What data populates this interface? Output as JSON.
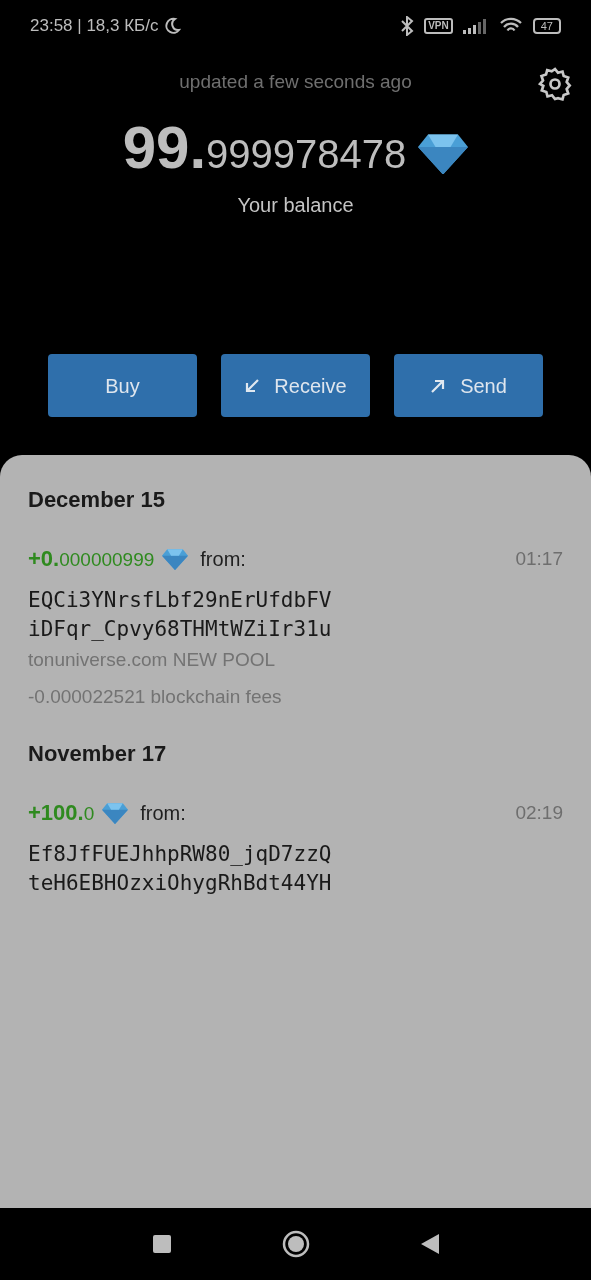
{
  "status_bar": {
    "time": "23:58 | 18,3 КБ/с",
    "vpn": "VPN",
    "battery": "47"
  },
  "header": {
    "updated": "updated a few seconds ago"
  },
  "balance": {
    "whole": "99.",
    "fraction": "999978478",
    "label": "Your balance"
  },
  "actions": [
    {
      "kind": "buy",
      "label": "Buy"
    },
    {
      "kind": "receive",
      "label": "Receive"
    },
    {
      "kind": "send",
      "label": "Send"
    }
  ],
  "groups": [
    {
      "date": "December 15",
      "transactions": [
        {
          "whole": "+0.",
          "fraction": "000000999",
          "direction": "from:",
          "time": "01:17",
          "address": [
            "EQCi3YNrsfLbf29nErUfdbFV",
            "iDFqr_Cpvy68THMtWZiIr31u"
          ],
          "comment": "tonuniverse.com NEW POOL",
          "fee": "-0.000022521 blockchain fees"
        }
      ]
    },
    {
      "date": "November 17",
      "transactions": [
        {
          "whole": "+100.",
          "fraction": "0",
          "direction": "from:",
          "time": "02:19",
          "address": [
            "Ef8JfFUEJhhpRW80_jqD7zzQ",
            "teH6EBHOzxiOhygRhBdt44YH"
          ]
        }
      ]
    }
  ]
}
